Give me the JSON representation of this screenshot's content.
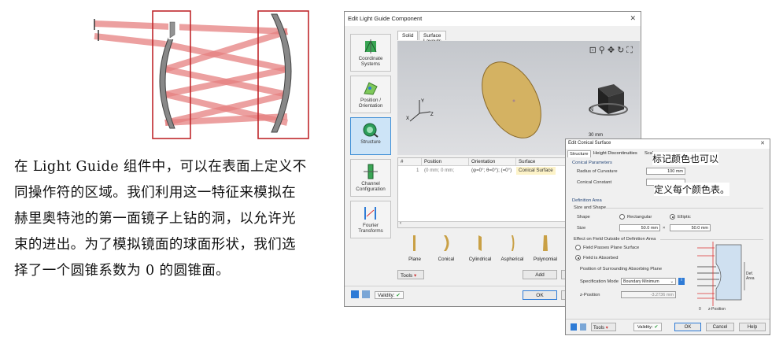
{
  "paragraph": "在 Light Guide 组件中，可以在表面上定义不同操作符的区域。我们利用这一特征来模拟在赫里奥特池的第一面镜子上钻的洞，以允许光束的进出。为了模拟镜面的球面形状，我们选择了一个圆锥系数为 0 的圆锥面。",
  "main_dialog": {
    "title": "Edit Light Guide Component",
    "sidebar": [
      {
        "label": "Coordinate Systems"
      },
      {
        "label": "Position / Orientation"
      },
      {
        "label": "Structure"
      },
      {
        "label": "Channel Configuration"
      },
      {
        "label": "Fourier Transforms"
      }
    ],
    "tabs": [
      "Solid",
      "Surface Layouts"
    ],
    "scale_label": "30 mm",
    "table": {
      "headers": [
        "#",
        "Position",
        "Orientation",
        "Surface"
      ],
      "row": [
        "1",
        "(0 mm; 0 mm;",
        "(φ=0°; θ=0°); (=0°)",
        "Conical Surface"
      ]
    },
    "shapes": [
      "Plane",
      "Conical",
      "Cylindrical",
      "Aspherical",
      "Polynomial"
    ],
    "tools_label": "Tools",
    "add_label": "Add",
    "validity_label": "Validity:",
    "ok_label": "OK"
  },
  "conical_dialog": {
    "title": "Edit Conical Surface",
    "tabs": [
      "Structure",
      "Height Discontinuities",
      "Scale"
    ],
    "section_conical": "Conical Parameters",
    "radius_label": "Radius of Curvature",
    "radius_value": "100 mm",
    "conic_label": "Conical Constant",
    "conic_value": "",
    "section_def": "Definition Area",
    "size_shape": "Size and Shape",
    "shape_label": "Shape",
    "rect_label": "Rectangular",
    "elliptic_label": "Elliptic",
    "size_label": "Size",
    "size_x": "50.0 mm",
    "times": "×",
    "size_y": "50.0 mm",
    "effect_label": "Effect on Field Outside of Definition Area",
    "passes_label": "Field Passes Plane Surface",
    "absorbed_label": "Field is Absorbed",
    "position_label": "Position of Surrounding Absorbing Plane",
    "spec_label": "Specification Mode",
    "spec_value": "Boundary Minimum",
    "zpos_label": "z-Position",
    "zpos_value": "-3.2736 mm",
    "fig_def": "Def. Area",
    "fig_zero": "0",
    "fig_z": "z-Position",
    "tools_label": "Tools",
    "validity_label": "Validity:",
    "ok_label": "OK",
    "cancel_label": "Cancel",
    "help_label": "Help"
  },
  "annotation": [
    "标记颜色也可以",
    "定义每个颜色表。"
  ],
  "colors": {
    "beam": "#e06a6a",
    "box": "#c0282c",
    "mirror": "#777777",
    "accent": "#2e7bd6",
    "disk": "#d4b262"
  }
}
